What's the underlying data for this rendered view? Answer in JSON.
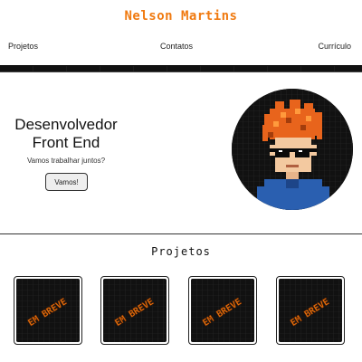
{
  "header": {
    "brand": "Nelson Martins"
  },
  "nav": {
    "items": [
      {
        "label": "Projetos"
      },
      {
        "label": "Contatos"
      },
      {
        "label": "Currículo"
      }
    ]
  },
  "hero": {
    "title_line1": "Desenvolvedor",
    "title_line2": "Front End",
    "subtitle": "Vamos trabalhar juntos?",
    "cta_label": "Vamos!"
  },
  "projects": {
    "title": "Projetos",
    "cards": [
      {
        "text": "EM BREVE"
      },
      {
        "text": "EM BREVE"
      },
      {
        "text": "EM BREVE"
      },
      {
        "text": "EM BREVE"
      }
    ]
  },
  "colors": {
    "accent": "#f07a10",
    "dark": "#111111",
    "shirt": "#2a5fb0",
    "hair": "#e8641c"
  }
}
